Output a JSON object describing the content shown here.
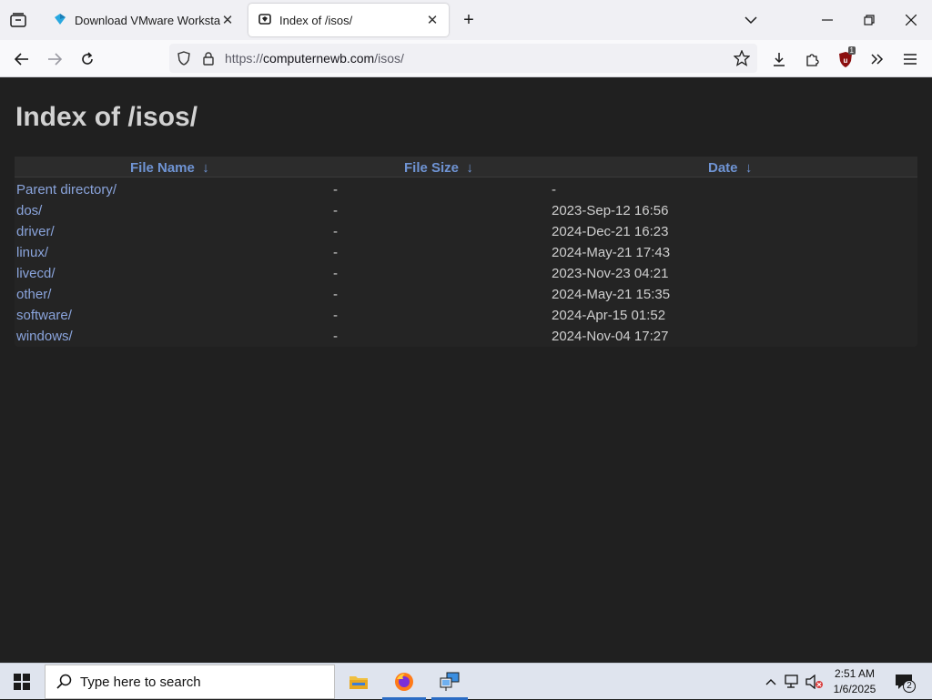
{
  "browser": {
    "tabs": [
      {
        "title": "Download VMware Workstation Pro"
      },
      {
        "title": "Index of /isos/"
      }
    ],
    "url": {
      "scheme": "https://",
      "host": "computernewb.com",
      "path": "/isos/"
    },
    "extension_badge": "1"
  },
  "page": {
    "heading": "Index of /isos/",
    "columns": {
      "name": "File Name  ↓",
      "size": "File Size  ↓",
      "date": "Date  ↓"
    },
    "rows": [
      {
        "name": "Parent directory/",
        "size": "-",
        "date": "-"
      },
      {
        "name": "dos/",
        "size": "-",
        "date": "2023-Sep-12 16:56"
      },
      {
        "name": "driver/",
        "size": "-",
        "date": "2024-Dec-21 16:23"
      },
      {
        "name": "linux/",
        "size": "-",
        "date": "2024-May-21 17:43"
      },
      {
        "name": "livecd/",
        "size": "-",
        "date": "2023-Nov-23 04:21"
      },
      {
        "name": "other/",
        "size": "-",
        "date": "2024-May-21 15:35"
      },
      {
        "name": "software/",
        "size": "-",
        "date": "2024-Apr-15 01:52"
      },
      {
        "name": "windows/",
        "size": "-",
        "date": "2024-Nov-04 17:27"
      }
    ]
  },
  "taskbar": {
    "search_placeholder": "Type here to search",
    "time": "2:51 AM",
    "date": "1/6/2025",
    "notification_count": "2"
  },
  "colors": {
    "page_bg": "#202020",
    "link": "#8aa4dc",
    "header_text": "#6f94d4",
    "heading_text": "#d2d2d2"
  }
}
